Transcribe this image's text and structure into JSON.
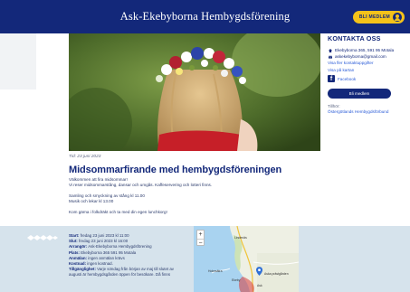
{
  "header": {
    "site_title": "Ask-Ekebyborna Hembygdsförening",
    "member_button": "BLI MEDLEM"
  },
  "sidebar": {
    "title": "KONTAKTA OSS",
    "address": "Ekebyborna 365, 591 95 Motala",
    "email": "askekebyborna@gmail.com",
    "more_contacts": "Visa fler kontaktuppgifter",
    "show_map": "Visa på kartan",
    "facebook": "Facebook",
    "join_button": "Bli medlem",
    "belongs_label": "Tillhör:",
    "belongs_link": "Östergötlands Hembygdsförbund"
  },
  "article": {
    "date": "Tid: 23 juni 2023",
    "title": "Midsommarfirande med hembygdsföreningen",
    "paragraphs": [
      "Välkommen att fira midsommar!",
      "Vi reser midsommarstång, dansar och umgås. Kaffeservering och lotteri finns.",
      "",
      "Samling och smyckning av stång kl 11.00",
      "Musik och lekar kl 13.00",
      "",
      "Kom gärna i folkdräkt och ta med din egen lunchkorg!"
    ]
  },
  "event_info": [
    {
      "label": "Start:",
      "value": "fredag 23 juni 2023 kl 11:00"
    },
    {
      "label": "Slut:",
      "value": "fredag 23 juni 2023 kl 16:00"
    },
    {
      "label": "Arrangör:",
      "value": "Ask-Ekebyborna Hembygdsförening"
    },
    {
      "label": "Plats:",
      "value": "Ekebyborna 365 591 95 Motala"
    },
    {
      "label": "Anmälan:",
      "value": "ingen anmälan krävs"
    },
    {
      "label": "Kostnad:",
      "value": "ingen kostnad."
    },
    {
      "label": "Tillgänglighet:",
      "value": "Varje söndag från början av maj till slutet av"
    },
    {
      "label": "",
      "value": "augusti är hembygdsgården öppen för besökare. Då finns"
    }
  ],
  "map": {
    "zoom_in": "+",
    "zoom_out": "−",
    "labels": [
      "Lindenäs",
      "Holmsätra",
      "Ekeby",
      "Aska prästgården",
      "Ask"
    ]
  },
  "colors": {
    "navy": "#13287a",
    "yellow": "#f4c21a",
    "band": "#d6e3ec",
    "link": "#2a5bd7"
  },
  "icons": [
    "user-icon",
    "home-icon",
    "email-icon",
    "facebook-icon",
    "map-pin-icon",
    "ornament-icon"
  ]
}
